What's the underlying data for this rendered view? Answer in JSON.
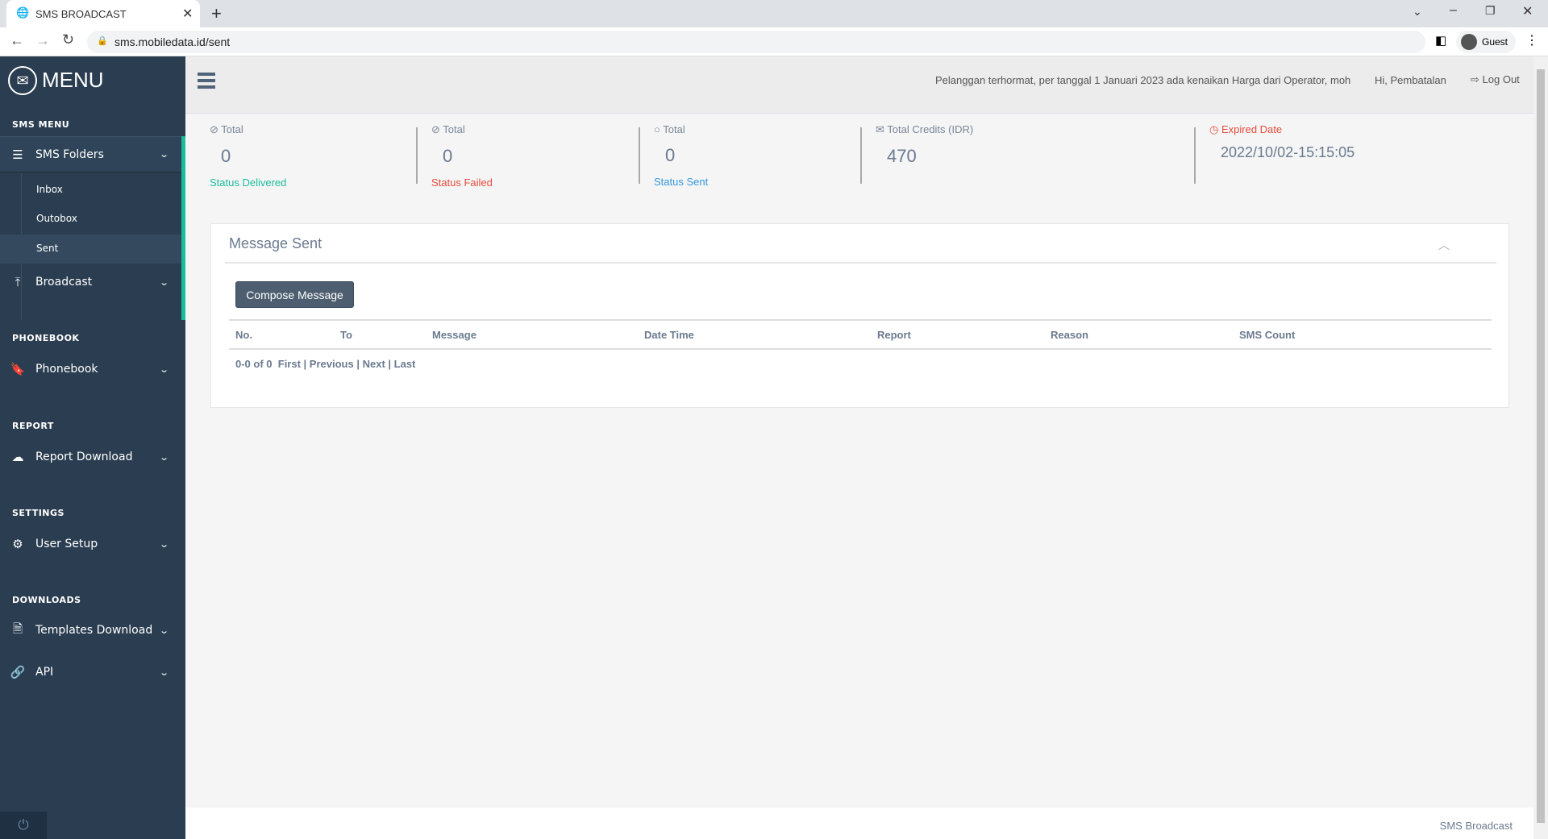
{
  "browser": {
    "tab_title": "SMS BROADCAST",
    "url": "sms.mobiledata.id/sent",
    "profile": "Guest"
  },
  "sidebar": {
    "title": "MENU",
    "sections": {
      "sms_menu": "SMS MENU",
      "phonebook": "PHONEBOOK",
      "report": "REPORT",
      "settings": "SETTINGS",
      "downloads": "DOWNLOADS"
    },
    "sms_folders": "SMS Folders",
    "sub": [
      "Inbox",
      "Outobox",
      "Sent"
    ],
    "broadcast": "Broadcast",
    "phonebook": "Phonebook",
    "report_download": "Report Download",
    "user_setup": "User Setup",
    "templates_download": "Templates Download",
    "api": "API"
  },
  "topbar": {
    "notice": "Pelanggan terhormat, per tanggal 1 Januari 2023 ada kenaikan Harga dari Operator, moh",
    "greeting": "Hi, Pembatalan",
    "logout": "Log Out"
  },
  "stats": [
    {
      "label": "Total",
      "value": "0",
      "status": "Status Delivered",
      "color": "#1abc9c"
    },
    {
      "label": "Total",
      "value": "0",
      "status": "Status Failed",
      "color": "#e74c3c"
    },
    {
      "label": "Total",
      "value": "0",
      "status": "Status Sent",
      "color": "#3498db"
    },
    {
      "label": "Total Credits (IDR)",
      "value": "470"
    },
    {
      "label": "Expired Date",
      "value": "2022/10/02-15:15:05",
      "color": "#e74c3c"
    }
  ],
  "panel": {
    "title": "Message Sent",
    "compose": "Compose Message",
    "columns": [
      "No.",
      "To",
      "Message",
      "Date Time",
      "Report",
      "Reason",
      "SMS Count"
    ],
    "pagination": {
      "range": "0-0 of 0",
      "first": "First",
      "previous": "Previous",
      "next": "Next",
      "last": "Last"
    }
  },
  "footer": "SMS Broadcast"
}
